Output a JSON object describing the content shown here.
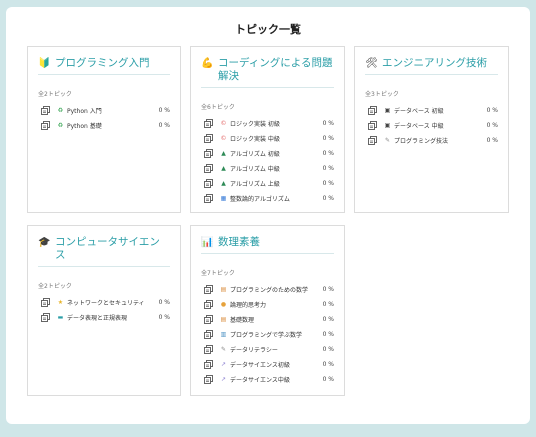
{
  "page": {
    "title": "トピック一覧"
  },
  "cards": [
    {
      "icon": "🔰",
      "title": "プログラミング入門",
      "count": "全2トピック",
      "items": [
        {
          "icon": "♻",
          "label": "Python 入門",
          "progress": "0 %"
        },
        {
          "icon": "♻",
          "label": "Python 基礎",
          "progress": "0 %"
        }
      ]
    },
    {
      "icon": "💪",
      "title": "コーディングによる問題解決",
      "count": "全6トピック",
      "items": [
        {
          "icon": "©",
          "label": "ロジック実装 初級",
          "progress": "0 %"
        },
        {
          "icon": "©",
          "label": "ロジック実装 中級",
          "progress": "0 %"
        },
        {
          "icon": "▲",
          "label": "アルゴリズム 初級",
          "progress": "0 %"
        },
        {
          "icon": "▲",
          "label": "アルゴリズム 中級",
          "progress": "0 %"
        },
        {
          "icon": "▲",
          "label": "アルゴリズム 上級",
          "progress": "0 %"
        },
        {
          "icon": "▦",
          "label": "整数論的アルゴリズム",
          "progress": "0 %"
        }
      ]
    },
    {
      "icon": "🛠",
      "title": "エンジニアリング技術",
      "count": "全3トピック",
      "items": [
        {
          "icon": "▣",
          "label": "データベース 初級",
          "progress": "0 %"
        },
        {
          "icon": "▣",
          "label": "データベース 中級",
          "progress": "0 %"
        },
        {
          "icon": "✎",
          "label": "プログラミング技法",
          "progress": "0 %"
        }
      ]
    },
    {
      "icon": "🎓",
      "title": "コンピュータサイエンス",
      "count": "全2トピック",
      "items": [
        {
          "icon": "★",
          "label": "ネットワークとセキュリティ",
          "progress": "0 %"
        },
        {
          "icon": "▬",
          "label": "データ表現と正規表現",
          "progress": "0 %"
        }
      ]
    },
    {
      "icon": "📊",
      "title": "数理素養",
      "count": "全7トピック",
      "items": [
        {
          "icon": "▤",
          "label": "プログラミングのための数学",
          "progress": "0 %"
        },
        {
          "icon": "●",
          "label": "論理的思考力",
          "progress": "0 %"
        },
        {
          "icon": "▤",
          "label": "基礎数理",
          "progress": "0 %"
        },
        {
          "icon": "▥",
          "label": "プログラミングで学ぶ数学",
          "progress": "0 %"
        },
        {
          "icon": "✎",
          "label": "データリテラシー",
          "progress": "0 %"
        },
        {
          "icon": "↗",
          "label": "データサイエンス初級",
          "progress": "0 %"
        },
        {
          "icon": "↗",
          "label": "データサイエンス中級",
          "progress": "0 %"
        }
      ]
    }
  ],
  "colors": {
    "accent": "#2b9ea7",
    "background": "#cfe6e8"
  }
}
